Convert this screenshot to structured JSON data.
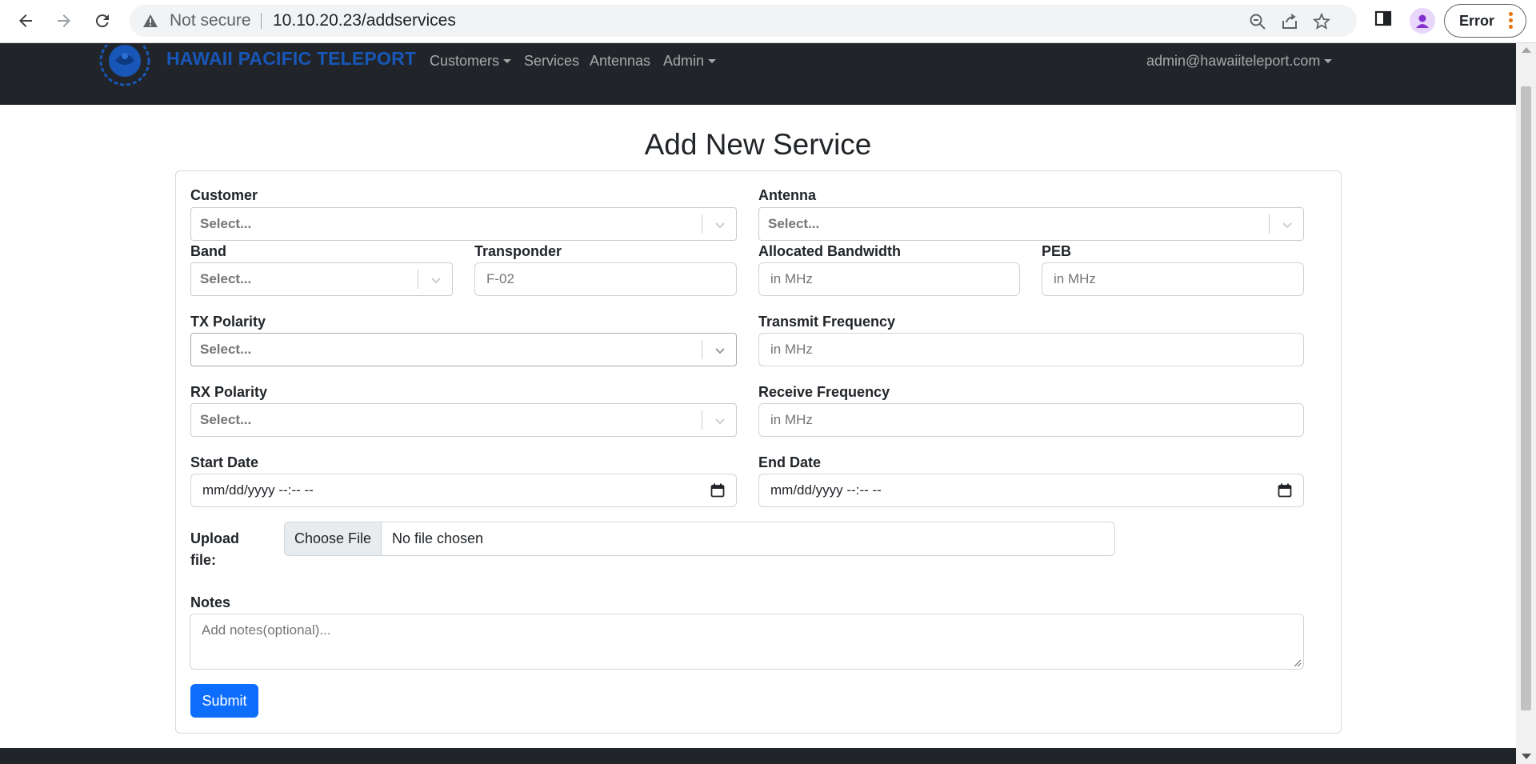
{
  "browser": {
    "security_label": "Not secure",
    "url": "10.10.20.23/addservices",
    "profile_status": "Error"
  },
  "navbar": {
    "brand": "HAWAII PACIFIC TELEPORT",
    "items": [
      {
        "label": "Customers",
        "dropdown": true
      },
      {
        "label": "Services",
        "dropdown": false
      },
      {
        "label": "Antennas",
        "dropdown": false
      },
      {
        "label": "Admin",
        "dropdown": true
      }
    ],
    "user": "admin@hawaiiteleport.com"
  },
  "form": {
    "title": "Add New Service",
    "customer": {
      "label": "Customer",
      "value": "Select..."
    },
    "antenna": {
      "label": "Antenna",
      "value": "Select..."
    },
    "band": {
      "label": "Band",
      "value": "Select..."
    },
    "transponder": {
      "label": "Transponder",
      "placeholder": "F-02"
    },
    "allocated_bandwidth": {
      "label": "Allocated Bandwidth",
      "placeholder": "in MHz"
    },
    "peb": {
      "label": "PEB",
      "placeholder": "in MHz"
    },
    "tx_polarity": {
      "label": "TX Polarity",
      "value": "Select..."
    },
    "transmit_frequency": {
      "label": "Transmit Frequency",
      "placeholder": "in MHz"
    },
    "rx_polarity": {
      "label": "RX Polarity",
      "value": "Select..."
    },
    "receive_frequency": {
      "label": "Receive Frequency",
      "placeholder": "in MHz"
    },
    "start_date": {
      "label": "Start Date",
      "value": "mm/dd/yyyy --:-- --"
    },
    "end_date": {
      "label": "End Date",
      "value": "mm/dd/yyyy --:-- --"
    },
    "upload": {
      "label_line1": "Upload",
      "label_line2": "file:",
      "button": "Choose File",
      "status": "No file chosen"
    },
    "notes": {
      "label": "Notes",
      "placeholder": "Add notes(optional)..."
    },
    "submit": "Submit"
  },
  "colors": {
    "navbar_bg": "#212529",
    "brand": "#1856b8",
    "primary": "#0d6efd"
  }
}
